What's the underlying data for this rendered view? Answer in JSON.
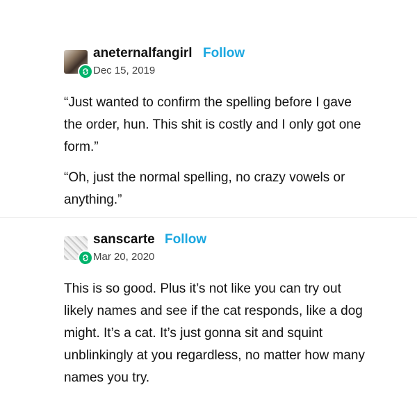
{
  "posts": [
    {
      "username": "aneternalfangirl",
      "follow_label": "Follow",
      "date": "Dec 15, 2019",
      "avatar_icon": "user-avatar",
      "badge_icon": "reblog-icon",
      "paragraphs": [
        "“Just wanted to confirm the spelling before I gave the order, hun. This shit is costly and I only got one form.”",
        "“Oh, just the normal spelling, no crazy vowels or anything.”"
      ]
    },
    {
      "username": "sanscarte",
      "follow_label": "Follow",
      "date": "Mar 20, 2020",
      "avatar_icon": "user-avatar",
      "badge_icon": "reblog-icon",
      "paragraphs": [
        "This is so good. Plus it’s not like you can try out likely names and see if the cat responds, like a dog might. It’s a cat. It’s just gonna sit and squint unblinkingly at you regardless, no matter how many names you try."
      ]
    }
  ],
  "colors": {
    "follow": "#1ba7e0",
    "badge": "#00b36b",
    "text": "#111111",
    "divider": "#e6e6e6"
  }
}
